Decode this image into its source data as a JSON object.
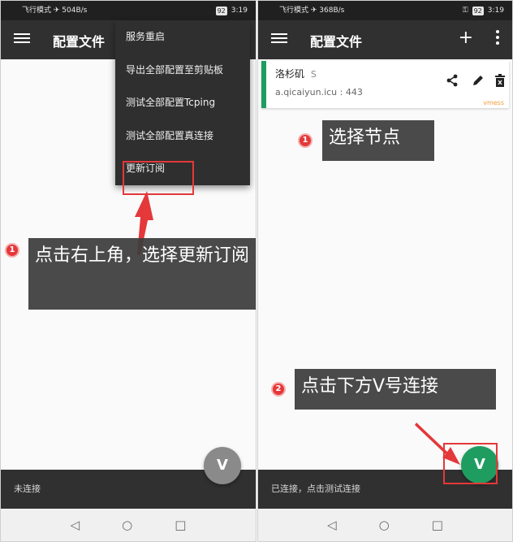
{
  "left": {
    "status_left": "飞行模式 ✈ 504B/s",
    "battery": "92",
    "time": "3:19",
    "title": "配置文件",
    "menu": [
      "服务重启",
      "导出全部配置至剪贴板",
      "测试全部配置Tcping",
      "测试全部配置真连接",
      "更新订阅"
    ],
    "status_text": "未连接",
    "fab_icon": "V",
    "callout_number": "1",
    "callout_text": "点击右上角，选择更新订阅"
  },
  "right": {
    "status_left": "飞行模式 ✈ 368B/s",
    "battery": "92",
    "time": "3:19",
    "title": "配置文件",
    "plus_icon": "+",
    "server": {
      "name": "洛杉矶",
      "tag": "S",
      "address": "a.qicaiyun.icu : 443",
      "protocol": "vmess"
    },
    "status_text": "已连接，点击测试连接",
    "fab_icon": "V",
    "callout1_number": "1",
    "callout1_text": "选择节点",
    "callout2_number": "2",
    "callout2_text": "点击下方V号连接"
  },
  "nav": {
    "back": "◁",
    "home": "○",
    "recent": "□"
  },
  "icons": {
    "share": "share-icon",
    "edit": "pencil-icon",
    "delete": "trash-icon"
  },
  "colors": {
    "accent_green": "#1f9d61",
    "annotation_red": "#e4383a",
    "vmess_orange": "#f29d38",
    "appbar": "#303030"
  }
}
